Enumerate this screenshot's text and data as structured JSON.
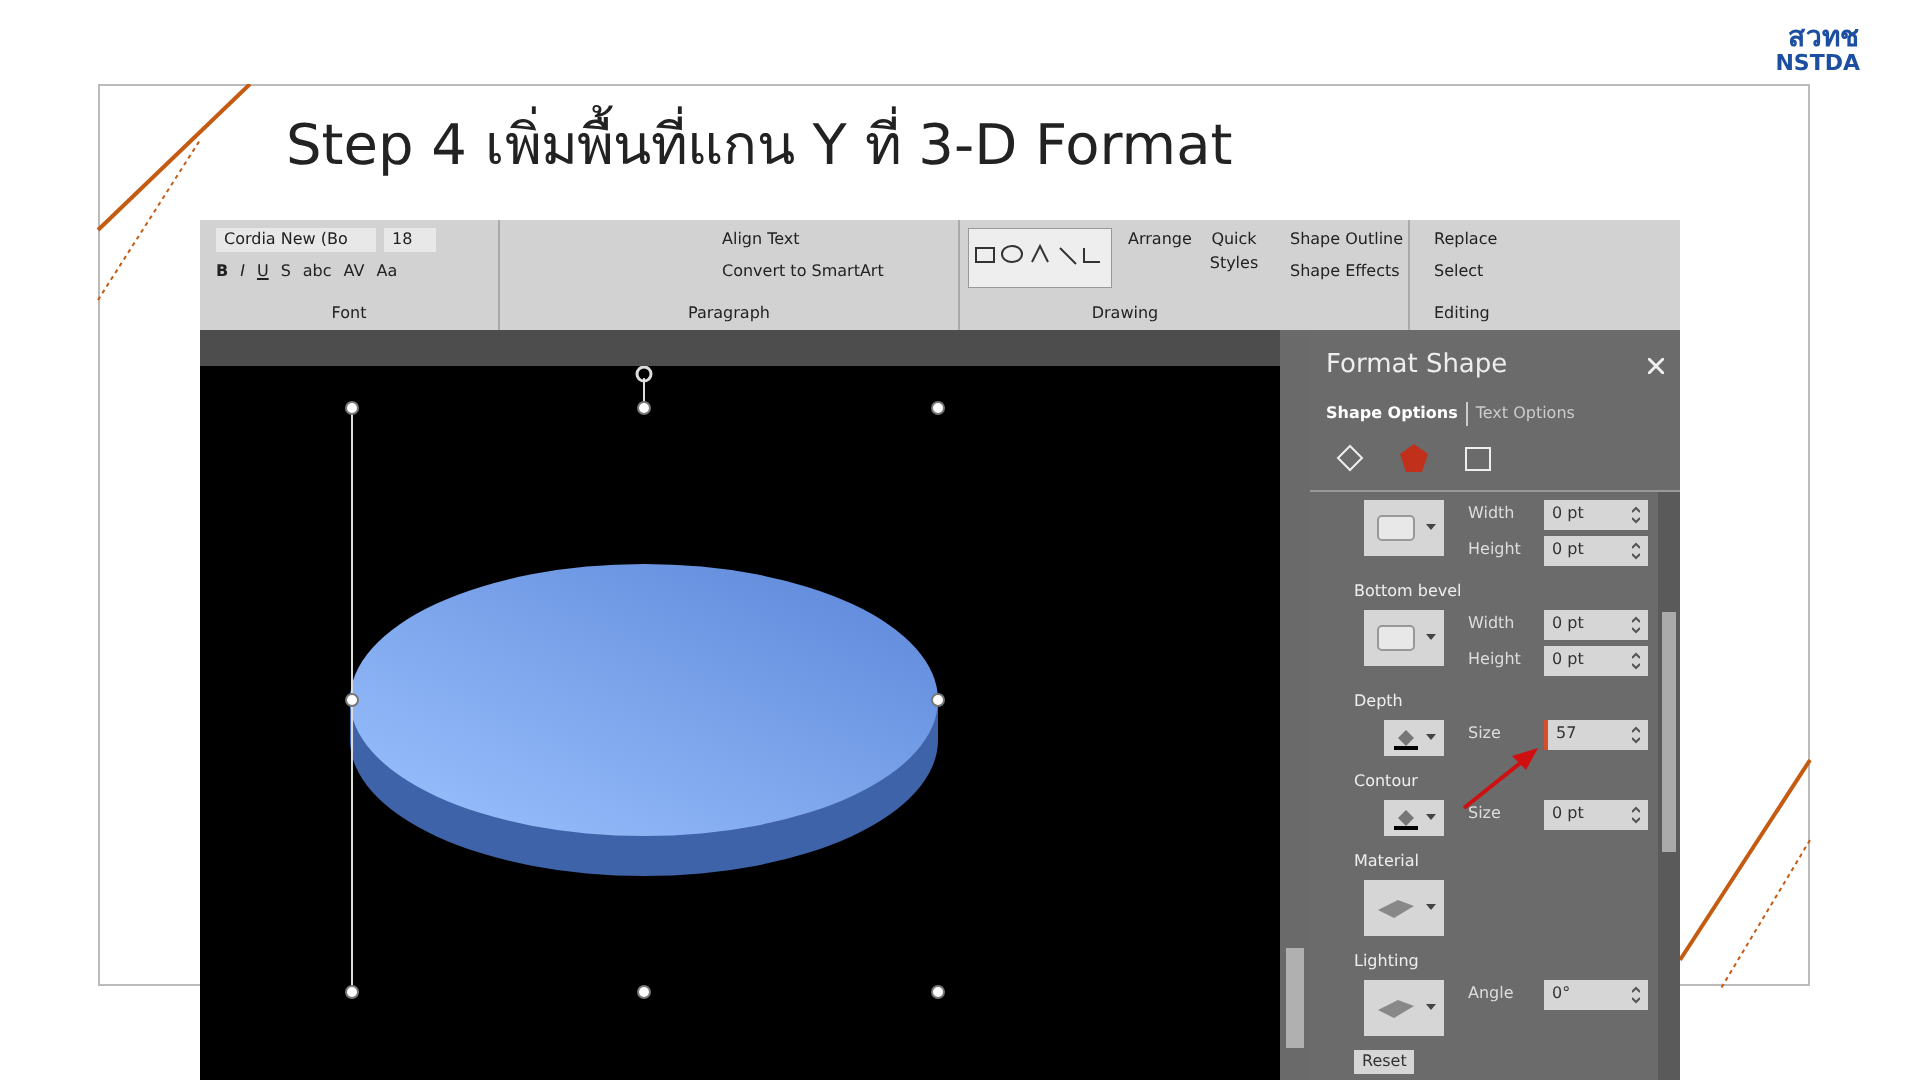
{
  "slide": {
    "title": "Step 4 เพิ่มพื้นที่แกน Y ที่ 3-D Format",
    "logo_thai": "สวทช",
    "logo_latin": "NSTDA"
  },
  "ribbon": {
    "font_name": "Cordia New (Bo",
    "font_size": "18",
    "format_buttons": [
      "B",
      "I",
      "U",
      "S",
      "abc",
      "AV",
      "Aa"
    ],
    "paragraph_items": [
      "Align Text",
      "Convert to SmartArt"
    ],
    "drawing_items": [
      "Arrange",
      "Quick Styles"
    ],
    "shape_items": [
      "Shape Outline",
      "Shape Effects"
    ],
    "editing_items": [
      "Replace",
      "Select"
    ],
    "groups": [
      "Font",
      "Paragraph",
      "Drawing",
      "Editing"
    ]
  },
  "format_panel": {
    "title": "Format Shape",
    "tabs": [
      {
        "label": "Shape Options",
        "selected": true
      },
      {
        "label": "Text Options",
        "selected": false
      }
    ],
    "icon_tabs": [
      {
        "kind": "fill",
        "selected": false
      },
      {
        "kind": "effects",
        "selected": true
      },
      {
        "kind": "size",
        "selected": false
      }
    ],
    "sections": [
      {
        "kind": "bevel",
        "fields": [
          {
            "label": "Width",
            "value": "0 pt",
            "focused": false
          },
          {
            "label": "Height",
            "value": "0 pt",
            "focused": false
          }
        ]
      },
      {
        "kind": "bevel",
        "label": "Bottom bevel",
        "fields": [
          {
            "label": "Width",
            "value": "0 pt",
            "focused": false
          },
          {
            "label": "Height",
            "value": "0 pt",
            "focused": false
          }
        ]
      },
      {
        "kind": "color",
        "label": "Depth",
        "fields": [
          {
            "label": "Size",
            "value": "57",
            "focused": true
          }
        ]
      },
      {
        "kind": "color",
        "label": "Contour",
        "fields": [
          {
            "label": "Size",
            "value": "0 pt",
            "focused": false
          }
        ]
      },
      {
        "kind": "material",
        "label": "Material"
      },
      {
        "kind": "lighting",
        "label": "Lighting",
        "fields": [
          {
            "label": "Angle",
            "value": "0°",
            "focused": false
          }
        ]
      }
    ],
    "reset_button": "Reset"
  }
}
